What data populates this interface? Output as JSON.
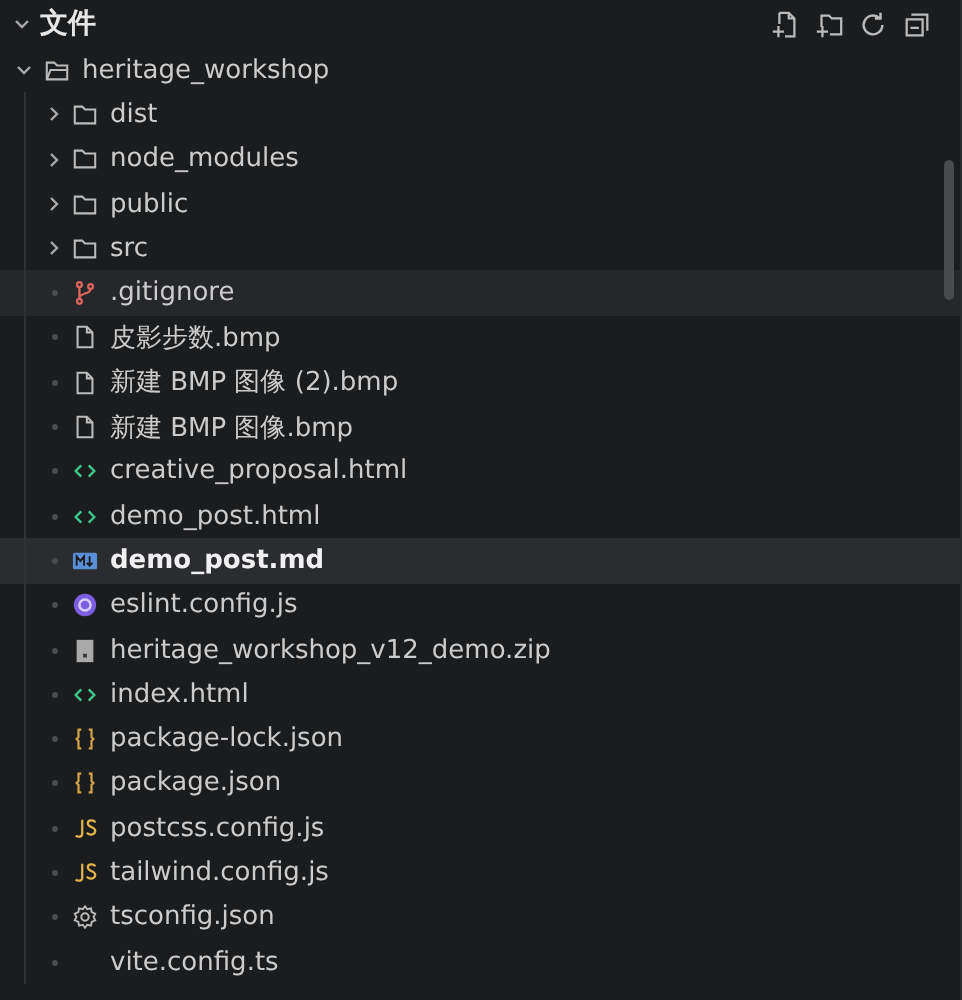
{
  "panel": {
    "title": "文件",
    "expanded": true
  },
  "tree": {
    "name": "heritage_workshop",
    "expanded": true,
    "children": [
      {
        "name": "dist",
        "kind": "folder",
        "expanded": false,
        "selected": false,
        "hovered": false
      },
      {
        "name": "node_modules",
        "kind": "folder",
        "expanded": false,
        "selected": false,
        "hovered": false
      },
      {
        "name": "public",
        "kind": "folder",
        "expanded": false,
        "selected": false,
        "hovered": false
      },
      {
        "name": "src",
        "kind": "folder",
        "expanded": false,
        "selected": false,
        "hovered": false
      },
      {
        "name": ".gitignore",
        "kind": "git",
        "selected": false,
        "hovered": true
      },
      {
        "name": "皮影步数.bmp",
        "kind": "file",
        "selected": false,
        "hovered": false
      },
      {
        "name": "新建 BMP 图像 (2).bmp",
        "kind": "file",
        "selected": false,
        "hovered": false
      },
      {
        "name": "新建 BMP 图像.bmp",
        "kind": "file",
        "selected": false,
        "hovered": false
      },
      {
        "name": "creative_proposal.html",
        "kind": "html",
        "selected": false,
        "hovered": false
      },
      {
        "name": "demo_post.html",
        "kind": "html",
        "selected": false,
        "hovered": false
      },
      {
        "name": "demo_post.md",
        "kind": "markdown",
        "selected": true,
        "hovered": false
      },
      {
        "name": "eslint.config.js",
        "kind": "eslint",
        "selected": false,
        "hovered": false
      },
      {
        "name": "heritage_workshop_v12_demo.zip",
        "kind": "zip",
        "selected": false,
        "hovered": false
      },
      {
        "name": "index.html",
        "kind": "html",
        "selected": false,
        "hovered": false
      },
      {
        "name": "package-lock.json",
        "kind": "json",
        "selected": false,
        "hovered": false
      },
      {
        "name": "package.json",
        "kind": "json",
        "selected": false,
        "hovered": false
      },
      {
        "name": "postcss.config.js",
        "kind": "js",
        "selected": false,
        "hovered": false
      },
      {
        "name": "tailwind.config.js",
        "kind": "js",
        "selected": false,
        "hovered": false
      },
      {
        "name": "tsconfig.json",
        "kind": "gear",
        "selected": false,
        "hovered": false
      },
      {
        "name": "vite.config.ts",
        "kind": "none",
        "selected": false,
        "hovered": false
      }
    ]
  }
}
